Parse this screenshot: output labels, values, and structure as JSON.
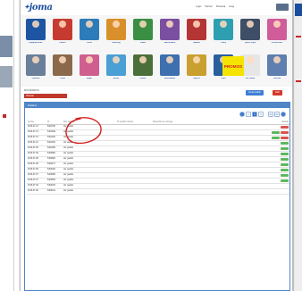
{
  "brand": {
    "logo": "joma",
    "accent": "#1e4fa1",
    "annotation_color": "#d42020"
  },
  "header": {
    "links": [
      "Login",
      "Partner",
      "Personal",
      "Lang"
    ]
  },
  "categories": [
    {
      "label": "Equipaciones",
      "color": "#1d55a3"
    },
    {
      "label": "Futbol",
      "color": "#c63b30"
    },
    {
      "label": "Tenis",
      "color": "#2d7bb8"
    },
    {
      "label": "Running",
      "color": "#d9902a"
    },
    {
      "label": "Padel",
      "color": "#3a8f44"
    },
    {
      "label": "Balonmano",
      "color": "#7a4ea0"
    },
    {
      "label": "Basket",
      "color": "#b53434"
    },
    {
      "label": "Voley",
      "color": "#2e9fb0"
    },
    {
      "label": "Sport Style",
      "color": "#3e4e66"
    },
    {
      "label": "Accesorios",
      "color": "#d05c9a"
    },
    {
      "label": "Calzado",
      "color": "#6a7f9a"
    },
    {
      "label": "Textil",
      "color": "#8a6a4a"
    },
    {
      "label": "Mujer",
      "color": "#cf5f8f"
    },
    {
      "label": "Junior",
      "color": "#4a9fd4"
    },
    {
      "label": "Outlet",
      "color": "#4b6f3a"
    },
    {
      "label": "Novedades",
      "color": "#3e6fae"
    },
    {
      "label": "Sports",
      "color": "#c9a030"
    },
    {
      "label": "Club",
      "color": "#2a5f9e"
    },
    {
      "label": "Sin Tallas",
      "color": "#e6e6e6"
    },
    {
      "label": "Ofertas",
      "color": "#5e7fb0"
    }
  ],
  "promo": "PROMOS",
  "breadcrumb": "MIS PEDIDOS",
  "actions": {
    "red_label": "Historial",
    "blue_label": "Crear pedido",
    "red_right_label": "Salir"
  },
  "panel_title": "Pedidos",
  "pager": {
    "prev": "<",
    "pages": [
      "1",
      "2",
      "3"
    ],
    "dots": "...",
    "next": ">",
    "extra": [
      "01",
      "02"
    ]
  },
  "table": {
    "columns": [
      "Fecha",
      "Nº",
      "Ref. pedido",
      "Nº pedido cliente",
      "Dirección de entrega",
      "Estado"
    ],
    "rows": [
      {
        "date": "2015-07-13",
        "num": "5461700",
        "prod": "Ver pedido",
        "client": "",
        "addr": "",
        "states": [
          {
            "t": "",
            "c": "#d9534f"
          }
        ]
      },
      {
        "date": "2015-07-13",
        "num": "5461609",
        "prod": "Ver pedido",
        "client": "",
        "addr": "",
        "states": [
          {
            "t": "",
            "c": "#5cb85c"
          },
          {
            "t": "",
            "c": "#d9534f"
          }
        ]
      },
      {
        "date": "2015-07-10",
        "num": "5461200",
        "prod": "Ver pedido",
        "client": "",
        "addr": "",
        "states": [
          {
            "t": "",
            "c": "#5cb85c"
          },
          {
            "t": "",
            "c": "#d9534f"
          }
        ]
      },
      {
        "date": "2015-07-10",
        "num": "5461180",
        "prod": "Ver pedido",
        "client": "",
        "addr": "",
        "states": [
          {
            "t": "",
            "c": "#5cb85c"
          }
        ]
      },
      {
        "date": "2015-07-09",
        "num": "5461055",
        "prod": "Ver pedido",
        "client": "",
        "addr": "",
        "states": [
          {
            "t": "",
            "c": "#5cb85c"
          }
        ]
      },
      {
        "date": "2015-07-09",
        "num": "5460800",
        "prod": "Ver pedido",
        "client": "",
        "addr": "",
        "states": [
          {
            "t": "",
            "c": "#5cb85c"
          }
        ]
      },
      {
        "date": "2015-07-08",
        "num": "5460500",
        "prod": "Ver pedido",
        "client": "",
        "addr": "",
        "states": [
          {
            "t": "",
            "c": "#5cb85c"
          }
        ]
      },
      {
        "date": "2015-07-08",
        "num": "5460477",
        "prod": "Ver pedido",
        "client": "",
        "addr": "",
        "states": [
          {
            "t": "",
            "c": "#5cb85c"
          }
        ]
      },
      {
        "date": "2015-07-08",
        "num": "5460400",
        "prod": "Ver pedido",
        "client": "",
        "addr": "",
        "states": [
          {
            "t": "",
            "c": "#5cb85c"
          }
        ]
      },
      {
        "date": "2015-07-07",
        "num": "5460055",
        "prod": "Ver pedido",
        "client": "",
        "addr": "",
        "states": [
          {
            "t": "",
            "c": "#5cb85c"
          }
        ]
      },
      {
        "date": "2015-07-07",
        "num": "5460054",
        "prod": "Ver pedido",
        "client": "",
        "addr": "",
        "states": [
          {
            "t": "",
            "c": "#5cb85c"
          }
        ]
      },
      {
        "date": "2015-07-06",
        "num": "5460016",
        "prod": "Ver pedido",
        "client": "",
        "addr": "",
        "states": []
      },
      {
        "date": "2015-07-06",
        "num": "5460014",
        "prod": "Ver pedido",
        "client": "",
        "addr": "",
        "states": []
      }
    ]
  }
}
